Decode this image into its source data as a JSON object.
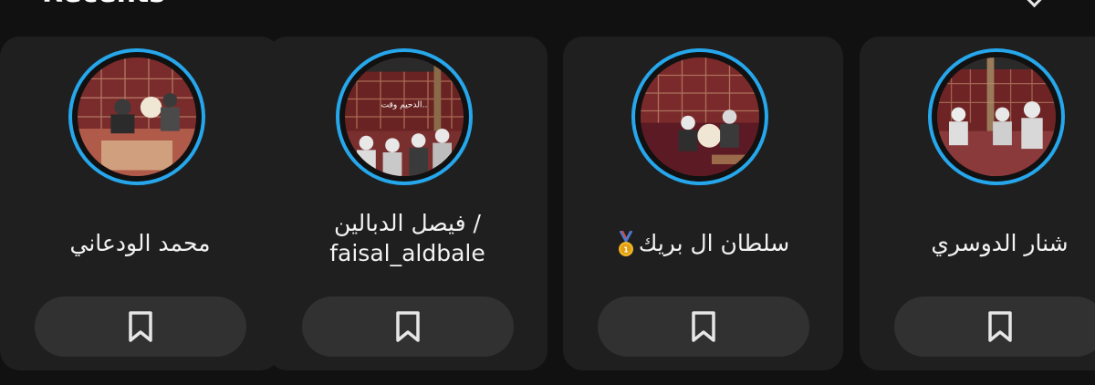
{
  "section": {
    "title": "Recents"
  },
  "cards": [
    {
      "name_line1": "فيصل الدبالين /",
      "name_line2": "faisal_aldbale",
      "photo_caption": "الدحيم وقت..",
      "icon": "bookmark-icon"
    },
    {
      "name": "سلطان ال بريك",
      "badge_icon": "first-place-medal-icon",
      "icon": "bookmark-icon"
    },
    {
      "name": "شنار الدوسري",
      "icon": "bookmark-icon"
    },
    {
      "name": "محمد الودعاني",
      "icon": "bookmark-icon"
    }
  ],
  "colors": {
    "background": "#111111",
    "card": "#1f1f1f",
    "button": "#313131",
    "ring": "#26a7ec",
    "text": "#f2f2f2"
  }
}
